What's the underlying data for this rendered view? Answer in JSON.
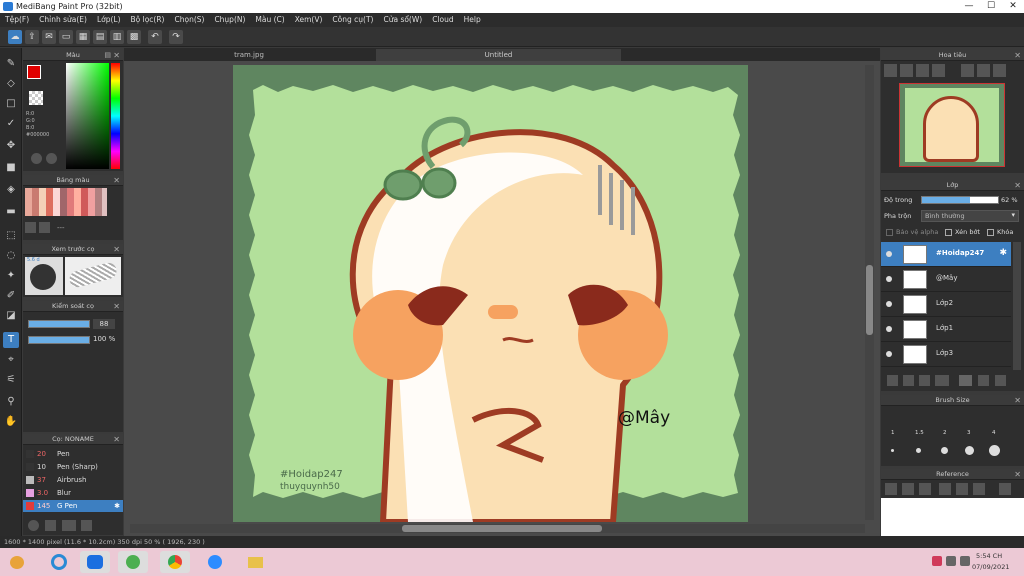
{
  "window": {
    "title": "MediBang Paint Pro (32bit)",
    "min": "—",
    "max": "☐",
    "close": "✕"
  },
  "menu": [
    "Tệp(F)",
    "Chỉnh sửa(E)",
    "Lớp(L)",
    "Bộ lọc(R)",
    "Chọn(S)",
    "Chụp(N)",
    "Màu (C)",
    "Xem(V)",
    "Công cụ(T)",
    "Cửa sổ(W)",
    "Cloud",
    "Help"
  ],
  "panels": {
    "color": {
      "title": "Màu",
      "r": "R:0",
      "g": "G:0",
      "b": "B:0",
      "hex": "#000000"
    },
    "palette": {
      "title": "Bảng màu",
      "dash": "---"
    },
    "brush_preview": {
      "title": "Xem trước cọ",
      "size": "5.6 d"
    },
    "brush_control": {
      "title": "Kiểm soát cọ",
      "size_val": "88",
      "opacity_val": "100 %"
    },
    "brush_list": {
      "title": "Cọ: NONAME",
      "items": [
        {
          "size": "20",
          "name": "Pen",
          "color": "#333"
        },
        {
          "size": "10",
          "name": "Pen (Sharp)",
          "color": "#333"
        },
        {
          "size": "37",
          "name": "Airbrush",
          "color": "#bbb"
        },
        {
          "size": "3.0",
          "name": "Blur",
          "color": "#e6a0e0"
        },
        {
          "size": "145",
          "name": "G Pen",
          "color": "#e23b3b"
        }
      ]
    },
    "navigator": {
      "title": "Hoa tiêu"
    },
    "layer": {
      "title": "Lớp",
      "opacity_label": "Độ trong",
      "opacity_val": "62 %",
      "blend_label": "Pha trộn",
      "blend_val": "Bình thường",
      "protect_alpha": "Bảo vệ alpha",
      "clip": "Xén bớt",
      "lock": "Khóa",
      "layers": [
        "#Hoidap247",
        "@Mây",
        "Lớp2",
        "Lớp1",
        "Lớp3"
      ]
    },
    "brush_size": {
      "title": "Brush Size",
      "labels": [
        "1",
        "1.5",
        "2",
        "3",
        "4"
      ]
    },
    "reference": {
      "title": "Reference"
    }
  },
  "tabs": {
    "t1": "tram.jpg",
    "t2": "Untitled"
  },
  "canvas": {
    "watermark1": "#Hoidap247",
    "watermark2": "thuyquynh50",
    "signature": "@Mây"
  },
  "status": "1600 * 1400 pixel  (11.6 * 10.2cm)  350 dpi  50 %  ( 1926, 230 )",
  "taskbar": {
    "time": "5:54 CH",
    "date": "07/09/2021"
  },
  "colors": {
    "accent": "#3d7fc1",
    "canvas_bg": "#5f8660",
    "canvas_inner": "#b3e09b",
    "fg": "#e00000"
  }
}
